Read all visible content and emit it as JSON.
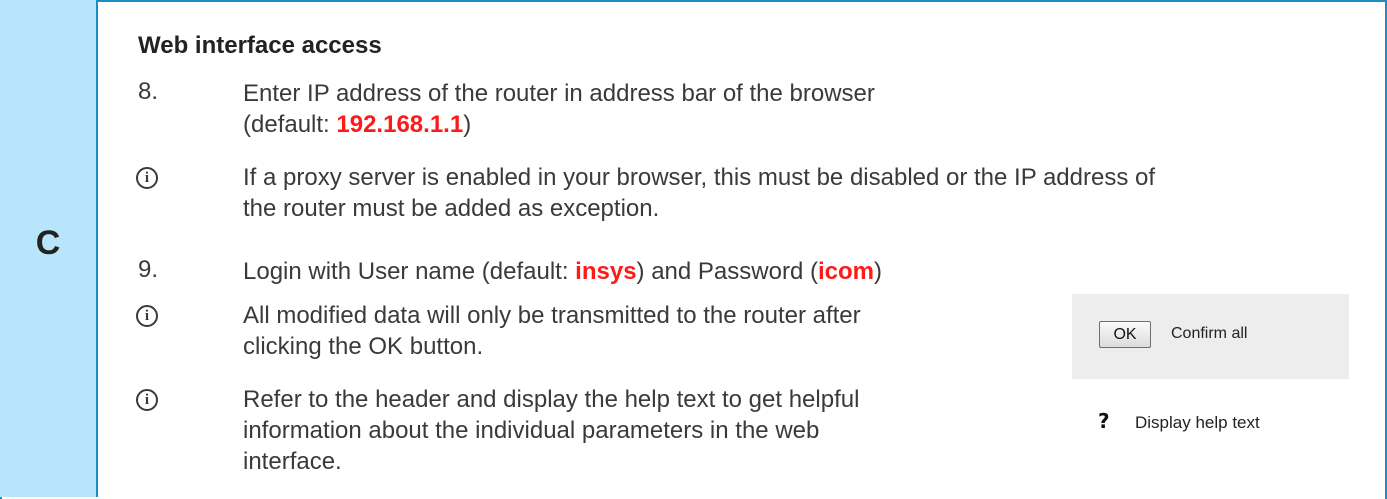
{
  "step": {
    "letter": "C"
  },
  "section": {
    "heading": "Web interface access"
  },
  "items": [
    {
      "marker": "8.",
      "line1": "Enter IP address of the router in address bar of the browser",
      "line2_prefix": "(default: ",
      "line2_value": "192.168.1.1",
      "line2_suffix": ")"
    },
    {
      "marker": "i",
      "line1": "If a proxy server is enabled in your browser, this must be disabled or the IP address of",
      "line2": "the router must be added as exception."
    },
    {
      "marker": "9.",
      "text_a": "Login with User name (default: ",
      "user_value": "insys",
      "text_b": ") and Password (",
      "password_value": "icom",
      "text_c": ")"
    },
    {
      "marker": "i",
      "line1": "All modified data will only be transmitted to the router after",
      "line2": "clicking the OK button."
    },
    {
      "marker": "i",
      "line1": "Refer to the header and display the help text to get helpful",
      "line2": "information about the individual parameters in the web",
      "line3": "interface."
    }
  ],
  "illustration": {
    "ok_button_label": "OK",
    "ok_caption": "Confirm all",
    "help_icon": "question-mark-icon",
    "help_label": "Display help text"
  },
  "colors": {
    "accent_border": "#1e8bc3",
    "step_column_bg": "#b7e5fb",
    "highlight": "#ff1a1a"
  }
}
